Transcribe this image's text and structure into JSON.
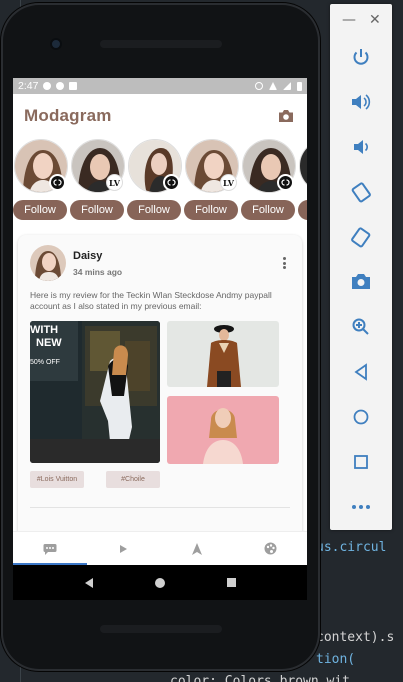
{
  "status_bar": {
    "time": "2:47"
  },
  "app": {
    "title": "Modagram",
    "follow_label": "Follow",
    "stories": [
      {
        "badge": "chanel"
      },
      {
        "badge": "louis-vuitton"
      },
      {
        "badge": "chanel"
      },
      {
        "badge": "louis-vuitton"
      },
      {
        "badge": "chanel"
      }
    ],
    "post": {
      "author": "Daisy",
      "time": "34 mins ago",
      "text": "Here is my review for the Teckin Wlan Steckdose Andmy paypall account as I also stated in my previous email:",
      "promo_line_1": "WITH",
      "promo_line_2": "NEW",
      "promo_line_3": "50% OFF",
      "tags": [
        "#Lois Vuitton",
        "#Choile"
      ]
    },
    "bottom_nav": [
      "chat-icon",
      "play-icon",
      "navigation-icon",
      "palette-icon"
    ]
  },
  "ide": {
    "lines": [
      "us.circul",
      "context).s",
      "tion(",
      "color: Colors.brown.wit"
    ]
  },
  "colors": {
    "brand": "#876458",
    "accent_blue": "#3f7fbf"
  }
}
